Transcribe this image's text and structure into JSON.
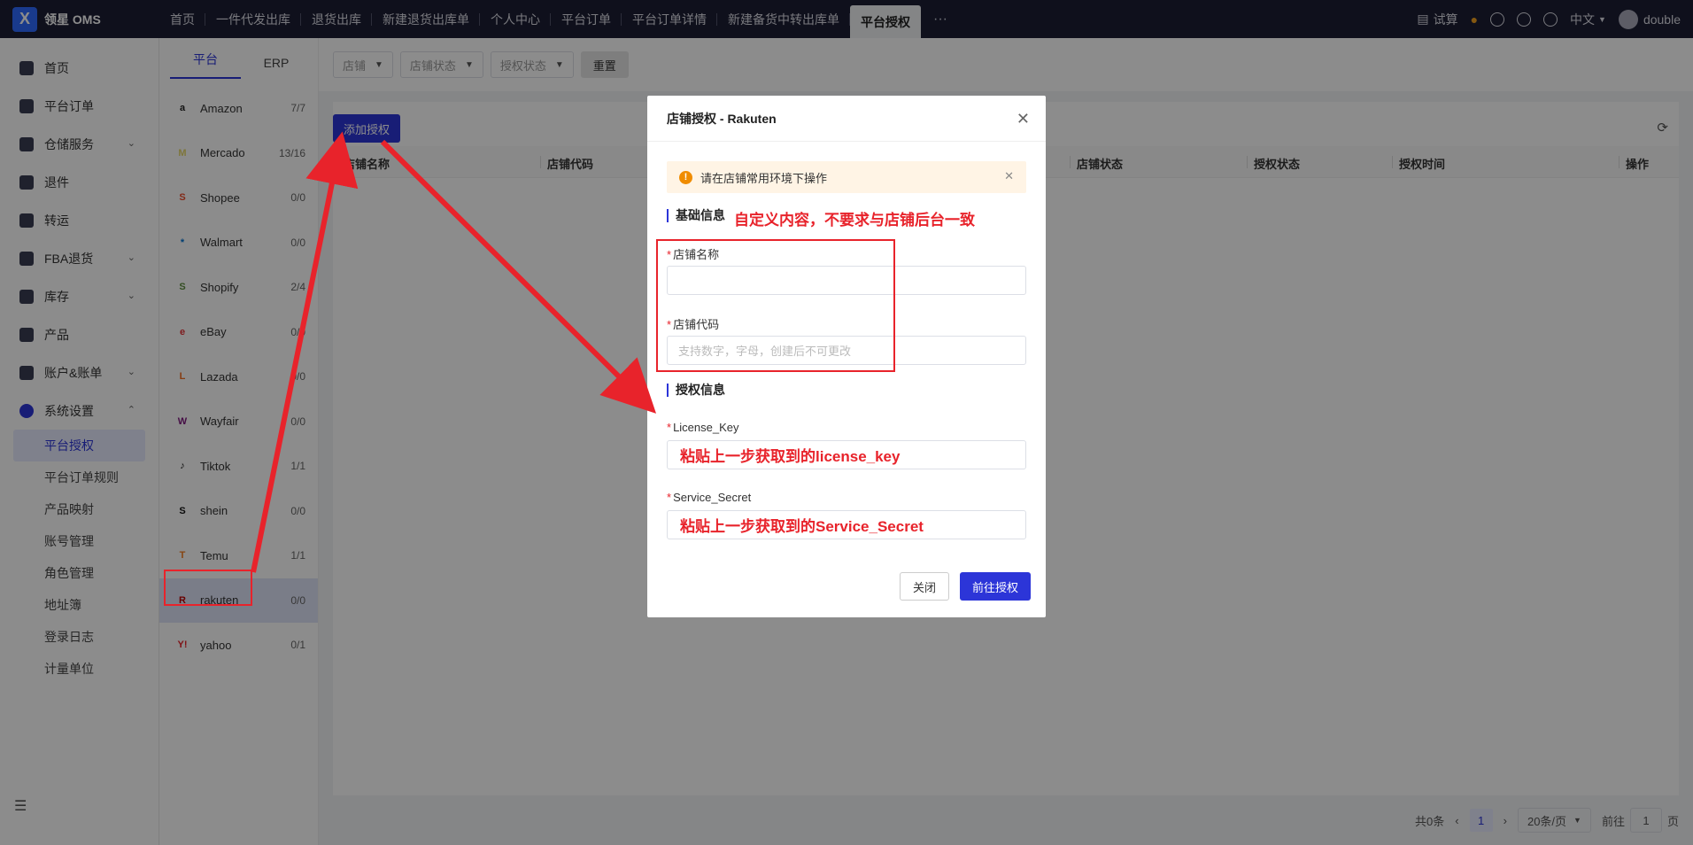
{
  "brand": {
    "name": "领星 OMS",
    "logo": "X"
  },
  "tabs": [
    "首页",
    "一件代发出库",
    "退货出库",
    "新建退货出库单",
    "个人中心",
    "平台订单",
    "平台订单详情",
    "新建备货中转出库单",
    "平台授权"
  ],
  "topright": {
    "trial": "试算",
    "lang": "中文",
    "user": "double"
  },
  "leftnav": {
    "items": [
      {
        "label": "首页"
      },
      {
        "label": "平台订单"
      },
      {
        "label": "仓储服务"
      },
      {
        "label": "退件"
      },
      {
        "label": "转运"
      },
      {
        "label": "FBA退货"
      },
      {
        "label": "库存"
      },
      {
        "label": "产品"
      },
      {
        "label": "账户&账单"
      },
      {
        "label": "系统设置"
      }
    ],
    "subitems": [
      "平台授权",
      "平台订单规则",
      "产品映射",
      "账号管理",
      "角色管理",
      "地址簿",
      "登录日志",
      "计量单位"
    ]
  },
  "platforms": {
    "tabs": [
      "平台",
      "ERP"
    ],
    "rows": [
      {
        "name": "Amazon",
        "count": "7/7",
        "color": "#222222",
        "glyph": "a"
      },
      {
        "name": "Mercado",
        "count": "13/16",
        "color": "#e6d76b",
        "glyph": "M"
      },
      {
        "name": "Shopee",
        "count": "0/0",
        "color": "#ee4d2d",
        "glyph": "S"
      },
      {
        "name": "Walmart",
        "count": "0/0",
        "color": "#0071ce",
        "glyph": "*"
      },
      {
        "name": "Shopify",
        "count": "2/4",
        "color": "#5e8e3e",
        "glyph": "S"
      },
      {
        "name": "eBay",
        "count": "0/0",
        "color": "#e53238",
        "glyph": "e"
      },
      {
        "name": "Lazada",
        "count": "0/0",
        "color": "#f36f21",
        "glyph": "L"
      },
      {
        "name": "Wayfair",
        "count": "0/0",
        "color": "#7f187f",
        "glyph": "W"
      },
      {
        "name": "Tiktok",
        "count": "1/1",
        "color": "#111111",
        "glyph": "♪"
      },
      {
        "name": "shein",
        "count": "0/0",
        "color": "#111111",
        "glyph": "S"
      },
      {
        "name": "Temu",
        "count": "1/1",
        "color": "#f57c1f",
        "glyph": "T"
      },
      {
        "name": "rakuten",
        "count": "0/0",
        "color": "#bf0000",
        "glyph": "R"
      },
      {
        "name": "yahoo",
        "count": "0/1",
        "color": "#e8232b",
        "glyph": "Y!"
      }
    ]
  },
  "filters": {
    "shop": "店铺",
    "shop_status": "店铺状态",
    "auth_status": "授权状态",
    "reset": "重置"
  },
  "table": {
    "add_button": "添加授权",
    "columns": [
      "店铺名称",
      "店铺代码",
      "店铺状态",
      "授权状态",
      "授权时间",
      "操作"
    ]
  },
  "pager": {
    "total": "共0条",
    "page": "1",
    "size": "20条/页",
    "goto": "前往",
    "goto_value": "1",
    "unit": "页"
  },
  "modal": {
    "title": "店铺授权 - Rakuten",
    "alert": "请在店铺常用环境下操作",
    "section_basic": "基础信息",
    "section_basic_note": "自定义内容，不要求与店铺后台一致",
    "shop_name_label": "店铺名称",
    "shop_code_label": "店铺代码",
    "shop_code_placeholder": "支持数字，字母，创建后不可更改",
    "section_auth": "授权信息",
    "license_label": "License_Key",
    "license_value": "粘贴上一步获取到的license_key",
    "secret_label": "Service_Secret",
    "secret_value": "粘贴上一步获取到的Service_Secret",
    "cancel": "关闭",
    "confirm": "前往授权"
  }
}
